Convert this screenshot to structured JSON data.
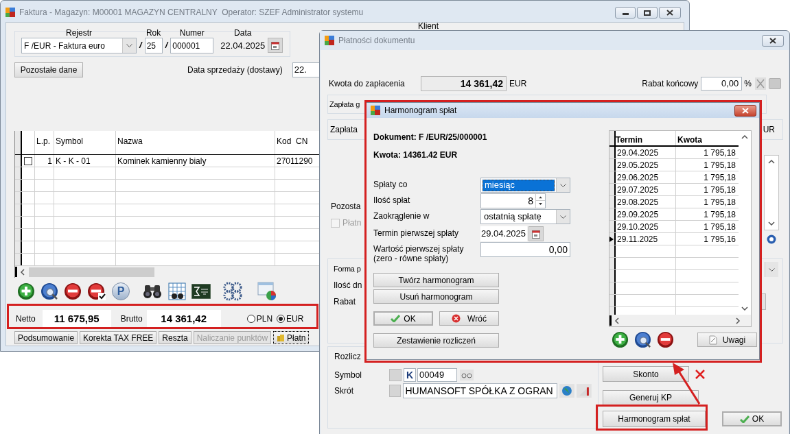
{
  "main_window": {
    "title": "Faktura - Magazyn: M00001 MAGAZYN CENTRALNY  Operator: SZEF Administrator systemu",
    "active": false,
    "register": {
      "label": "Rejestr",
      "value": "F /EUR - Faktura euro"
    },
    "slashes": [
      "/",
      "/"
    ],
    "year": {
      "label": "Rok",
      "value": "25"
    },
    "number": {
      "label": "Numer",
      "value": "000001"
    },
    "date": {
      "label": "Data",
      "value": "22.04.2025"
    },
    "other_data_button": "Pozostałe dane",
    "sale_date": {
      "label": "Data sprzedaży (dostawy)",
      "value": "22."
    },
    "client_label": "Klient",
    "table": {
      "columns": [
        "L.p.",
        "Symbol",
        "Nazwa",
        "Kod  CN"
      ],
      "rows": [
        {
          "checked": false,
          "cells": [
            "1",
            "K - K - 01",
            "Kominek kamienny bialy",
            "27011290"
          ]
        }
      ]
    },
    "toolbar_p": "P",
    "totals": {
      "net_label": "Netto",
      "net": "11 675,95",
      "gross_label": "Brutto",
      "gross": "14 361,42",
      "currencies": [
        {
          "label": "PLN",
          "selected": false
        },
        {
          "label": "EUR",
          "selected": true
        }
      ]
    },
    "buttons": [
      {
        "kind": "text",
        "label": "Podsumowanie",
        "disabled": false
      },
      {
        "kind": "text",
        "label": "Korekta TAX FREE",
        "disabled": false
      },
      {
        "kind": "text",
        "label": "Reszta",
        "disabled": false
      },
      {
        "kind": "text",
        "label": "Naliczanie punktów",
        "disabled": true
      },
      {
        "kind": "icon",
        "label": "Płatn",
        "disabled": false
      }
    ]
  },
  "payments_window": {
    "title": "Płatności dokumentu",
    "active": false,
    "amount_label": "Kwota do zapłacenia",
    "amount": "14 361,42",
    "amount_currency": "EUR",
    "discount_label": "Rabat końcowy",
    "discount": "0,00",
    "discount_unit": "%",
    "cash_label": "Zapłata g",
    "payment_label": "Zapłata",
    "payment_currency": "UR",
    "other_label": "Pozosta",
    "paid_checkbox": {
      "label": "Płatn",
      "checked": false,
      "disabled": true
    },
    "form_label": "Forma p",
    "days_label": "Ilość dn",
    "rebate_label": "Rabat",
    "settlement_label": "Rozlicz",
    "symbol_label": "Symbol",
    "symbol_prefix": "K",
    "symbol": "00049",
    "short_label": "Skrót",
    "short": "HUMANSOFT SPÓŁKA Z OGRAN",
    "discount_button": "Skonto",
    "kp_button": "Generuj KP",
    "schedule_button": "Harmonogram spłat",
    "ok_button": "OK"
  },
  "schedule_dialog": {
    "title": "Harmonogram spłat",
    "active": true,
    "document": "Dokument: F /EUR/25/000001",
    "amount": "Kwota: 14361.42 EUR",
    "fields": [
      {
        "kind": "combo",
        "label": "Spłaty co",
        "value": "miesiąc",
        "selected": true
      },
      {
        "kind": "spinner",
        "label": "Ilość spłat",
        "value": "8"
      },
      {
        "kind": "combo",
        "label": "Zaokrąglenie w",
        "value": "ostatnią spłatę",
        "selected": false
      },
      {
        "kind": "date",
        "label": "Termin pierwszej spłaty",
        "value": "29.04.2025"
      },
      {
        "kind": "number",
        "label": "Wartość pierwszej spłaty\n(zero - równe spłaty)",
        "value": "0,00"
      }
    ],
    "create_button": "Twórz harmonogram",
    "delete_button": "Usuń harmonogram",
    "ok_button": "OK",
    "back_button": "Wróć",
    "summary_button": "Zestawienie rozliczeń",
    "grid": {
      "columns": [
        "Termin",
        "Kwota"
      ],
      "rows": [
        {
          "date": "29.04.2025",
          "amount": "1 795,18",
          "selected": false
        },
        {
          "date": "29.05.2025",
          "amount": "1 795,18",
          "selected": false
        },
        {
          "date": "29.06.2025",
          "amount": "1 795,18",
          "selected": false
        },
        {
          "date": "29.07.2025",
          "amount": "1 795,18",
          "selected": false
        },
        {
          "date": "29.08.2025",
          "amount": "1 795,18",
          "selected": false
        },
        {
          "date": "29.09.2025",
          "amount": "1 795,18",
          "selected": false
        },
        {
          "date": "29.10.2025",
          "amount": "1 795,18",
          "selected": false
        },
        {
          "date": "29.11.2025",
          "amount": "1 795,16",
          "selected": true
        }
      ]
    },
    "notes_button": "Uwagi"
  }
}
